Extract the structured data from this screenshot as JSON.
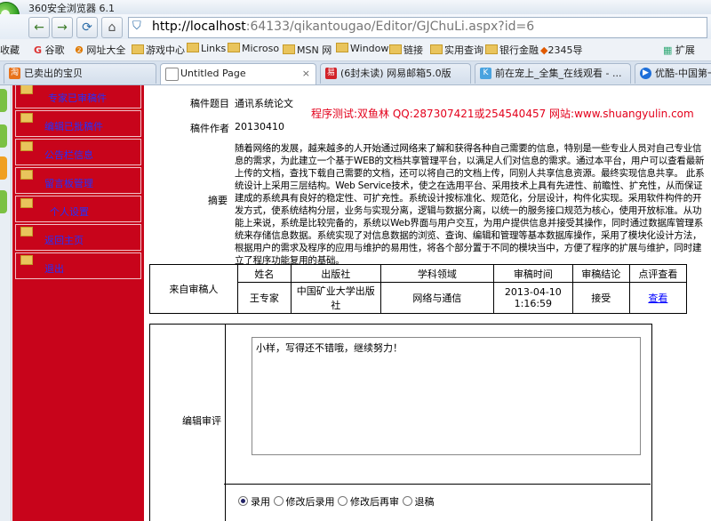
{
  "window": {
    "title": "360安全浏览器 6.1"
  },
  "nav": {
    "back_icon": "←",
    "forward_icon": "→",
    "refresh_icon": "⟳",
    "home_icon": "⌂",
    "url_host": "http://localhost",
    "url_rest": ":64133/qikantougao/Editor/GJChuLi.aspx?id=6"
  },
  "bookmarks": {
    "items": [
      "收藏",
      "谷歌",
      "网址大全",
      "游戏中心",
      "Links",
      "Microso",
      "MSN 网",
      "Window",
      "链接",
      "实用查询",
      "银行金融",
      "2345导"
    ],
    "extend": "扩展"
  },
  "tabs": [
    {
      "label": "已卖出的宝贝",
      "icon_color": "#e8731c"
    },
    {
      "label": "Untitled Page",
      "icon_color": "#7a8a9a"
    },
    {
      "label": "(6封未读) 网易邮箱5.0版",
      "icon_color": "#d2232a"
    },
    {
      "label": "前在宠上_全集_在线观看 - ...",
      "icon_color": "#4aa3df"
    },
    {
      "label": "优酷-中国第一",
      "icon_color": "#1e6fd9"
    }
  ],
  "sidebar": {
    "items": [
      "专家已审稿件",
      "编辑已批稿件",
      "公告栏信息",
      "留言板管理",
      "个人设置",
      "返回主页",
      "退出"
    ]
  },
  "paper": {
    "title_label": "稿件题目",
    "title_value": "通讯系统论文",
    "author_label": "稿件作者",
    "author_value": "20130410",
    "abstract_label": "摘要",
    "abstract_text": "随着网络的发展，越来越多的人开始通过网络来了解和获得各种自己需要的信息，特别是一些专业人员对自己专业信息的需求，为此建立一个基于WEB的文档共享管理平台，以满足人们对信息的需求。通过本平台，用户可以查看最新上传的文档，查找下载自己需要的文档，还可以将自己的文档上传，同别人共享信息资源。最终实现信息共享。  此系统设计上采用三层结构。Web Service技术，使之在选用平台、采用技术上具有先进性、前瞻性、扩充性，从而保证建成的系统具有良好的稳定性、可扩充性。系统设计按标准化、规范化，分层设计，构件化实现。采用软件构件的开发方式，使系统结构分层，业务与实现分离，逻辑与数据分离，以统一的服务接口规范为核心，使用开放标准。从功能上来说，系统是比较完备的，系统以Web界面与用户交互，为用户提供信息并接受其操作，同时通过数据库管理系统来存储信息数据。系统实现了对信息数据的浏览、查询、编辑和管理等基本数据库操作，采用了模块化设计方法，根据用户的需求及程序的应用与维护的易用性，将各个部分置于不同的模块当中，方便了程序的扩展与维护，同时建立了程序功能复用的基础。"
  },
  "watermark": "程序测试:双鱼林 QQ:287307421或254540457 网站:www.shuangyulin.com",
  "review": {
    "row_label": "来自审稿人",
    "headers": [
      "姓名",
      "出版社",
      "学科领域",
      "审稿时间",
      "审稿结论",
      "点评查看"
    ],
    "row": {
      "name": "王专家",
      "publisher": "中国矿业大学出版社",
      "field": "网络与通信",
      "time_line1": "2013-04-10",
      "time_line2": "1:16:59",
      "conclusion": "接受",
      "view": "查看"
    }
  },
  "editor_review": {
    "label": "编辑审评",
    "comment": "小样，写得还不错哦，继续努力！",
    "options": [
      "录用",
      "修改后录用",
      "修改后再审",
      "退稿"
    ],
    "selected": "录用"
  }
}
